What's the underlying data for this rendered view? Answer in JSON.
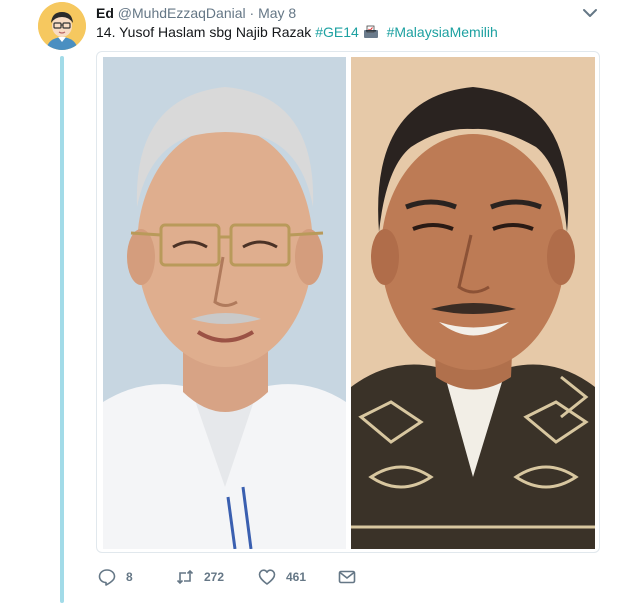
{
  "tweet": {
    "author_name": "Ed",
    "author_handle": "@MuhdEzzaqDanial",
    "separator": "·",
    "date": "May 8",
    "text_main": "14. Yusof Haslam sbg Najib Razak ",
    "hashtag_1": "#GE14",
    "hashtag_2": "#MalaysiaMemilih"
  },
  "actions": {
    "reply_count": "8",
    "retweet_count": "272",
    "like_count": "461"
  },
  "icons": {
    "avatar": "avatar-cartoon-icon",
    "caret": "chevron-down-icon",
    "emoji": "ballot-box-icon",
    "reply": "reply-icon",
    "retweet": "retweet-icon",
    "like": "heart-icon",
    "message": "envelope-icon"
  },
  "colors": {
    "hashtag": "#1da1a1",
    "thread_line": "#a2dbe8",
    "muted": "#657786"
  }
}
